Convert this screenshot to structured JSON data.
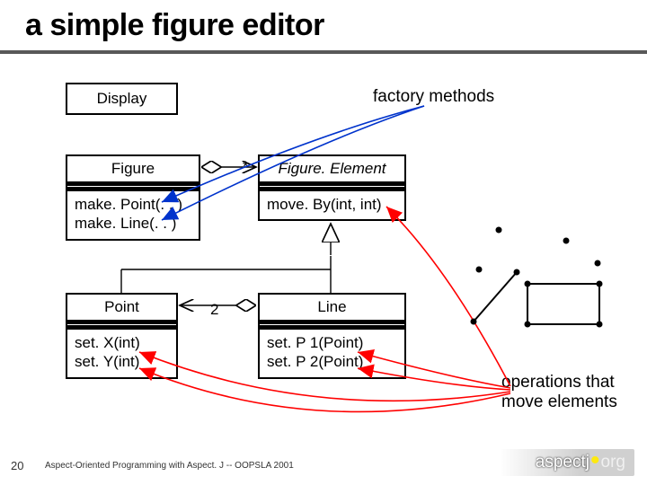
{
  "title": "a simple figure editor",
  "notes": {
    "factory": "factory methods",
    "ops": "operations that move elements"
  },
  "classes": {
    "display": {
      "name": "Display"
    },
    "figure": {
      "name": "Figure",
      "ops": [
        "make. Point(. . )",
        "make. Line(. . )"
      ]
    },
    "figelem": {
      "name": "Figure. Element",
      "ops": [
        "move. By(int, int)"
      ]
    },
    "point": {
      "name": "Point",
      "ops": [
        "set. X(int)",
        "set. Y(int)"
      ]
    },
    "line": {
      "name": "Line",
      "ops": [
        "set. P 1(Point)",
        "set. P 2(Point)"
      ]
    }
  },
  "multiplicities": {
    "star": "*",
    "two": "2"
  },
  "footer": "Aspect-Oriented Programming with Aspect. J -- OOPSLA 2001",
  "pagenum": "20",
  "logo": {
    "a": "aspect",
    "b": "org"
  },
  "colors": {
    "arrow_red": "#ff0000",
    "factory_blue": "#0033cc"
  }
}
